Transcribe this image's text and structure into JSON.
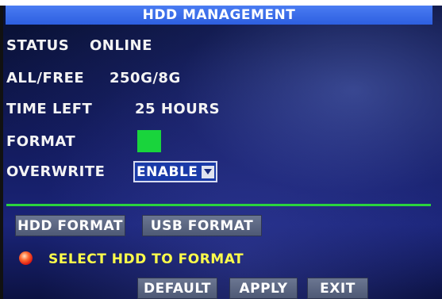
{
  "title": "HDD MANAGEMENT",
  "rows": {
    "status": {
      "label": "STATUS",
      "value": "ONLINE"
    },
    "all_free": {
      "label": "ALL/FREE",
      "value": "250G/8G"
    },
    "time_left": {
      "label": "TIME LEFT",
      "value": "25 HOURS"
    },
    "format": {
      "label": "FORMAT",
      "checked": true,
      "color": "#19d43c"
    },
    "overwrite": {
      "label": "OVERWRITE",
      "value": "ENABLE"
    }
  },
  "buttons": {
    "hdd_format": "HDD FORMAT",
    "usb_format": "USB FORMAT",
    "default": "DEFAULT",
    "apply": "APPLY",
    "exit": "EXIT"
  },
  "hint": {
    "text": "SELECT HDD TO FORMAT",
    "icon": "red-status-dot-icon"
  },
  "colors": {
    "title_bar": "#2d5fe0",
    "divider": "#2bd43e",
    "hint_text": "#ffff4a",
    "button": "#5e6984"
  }
}
